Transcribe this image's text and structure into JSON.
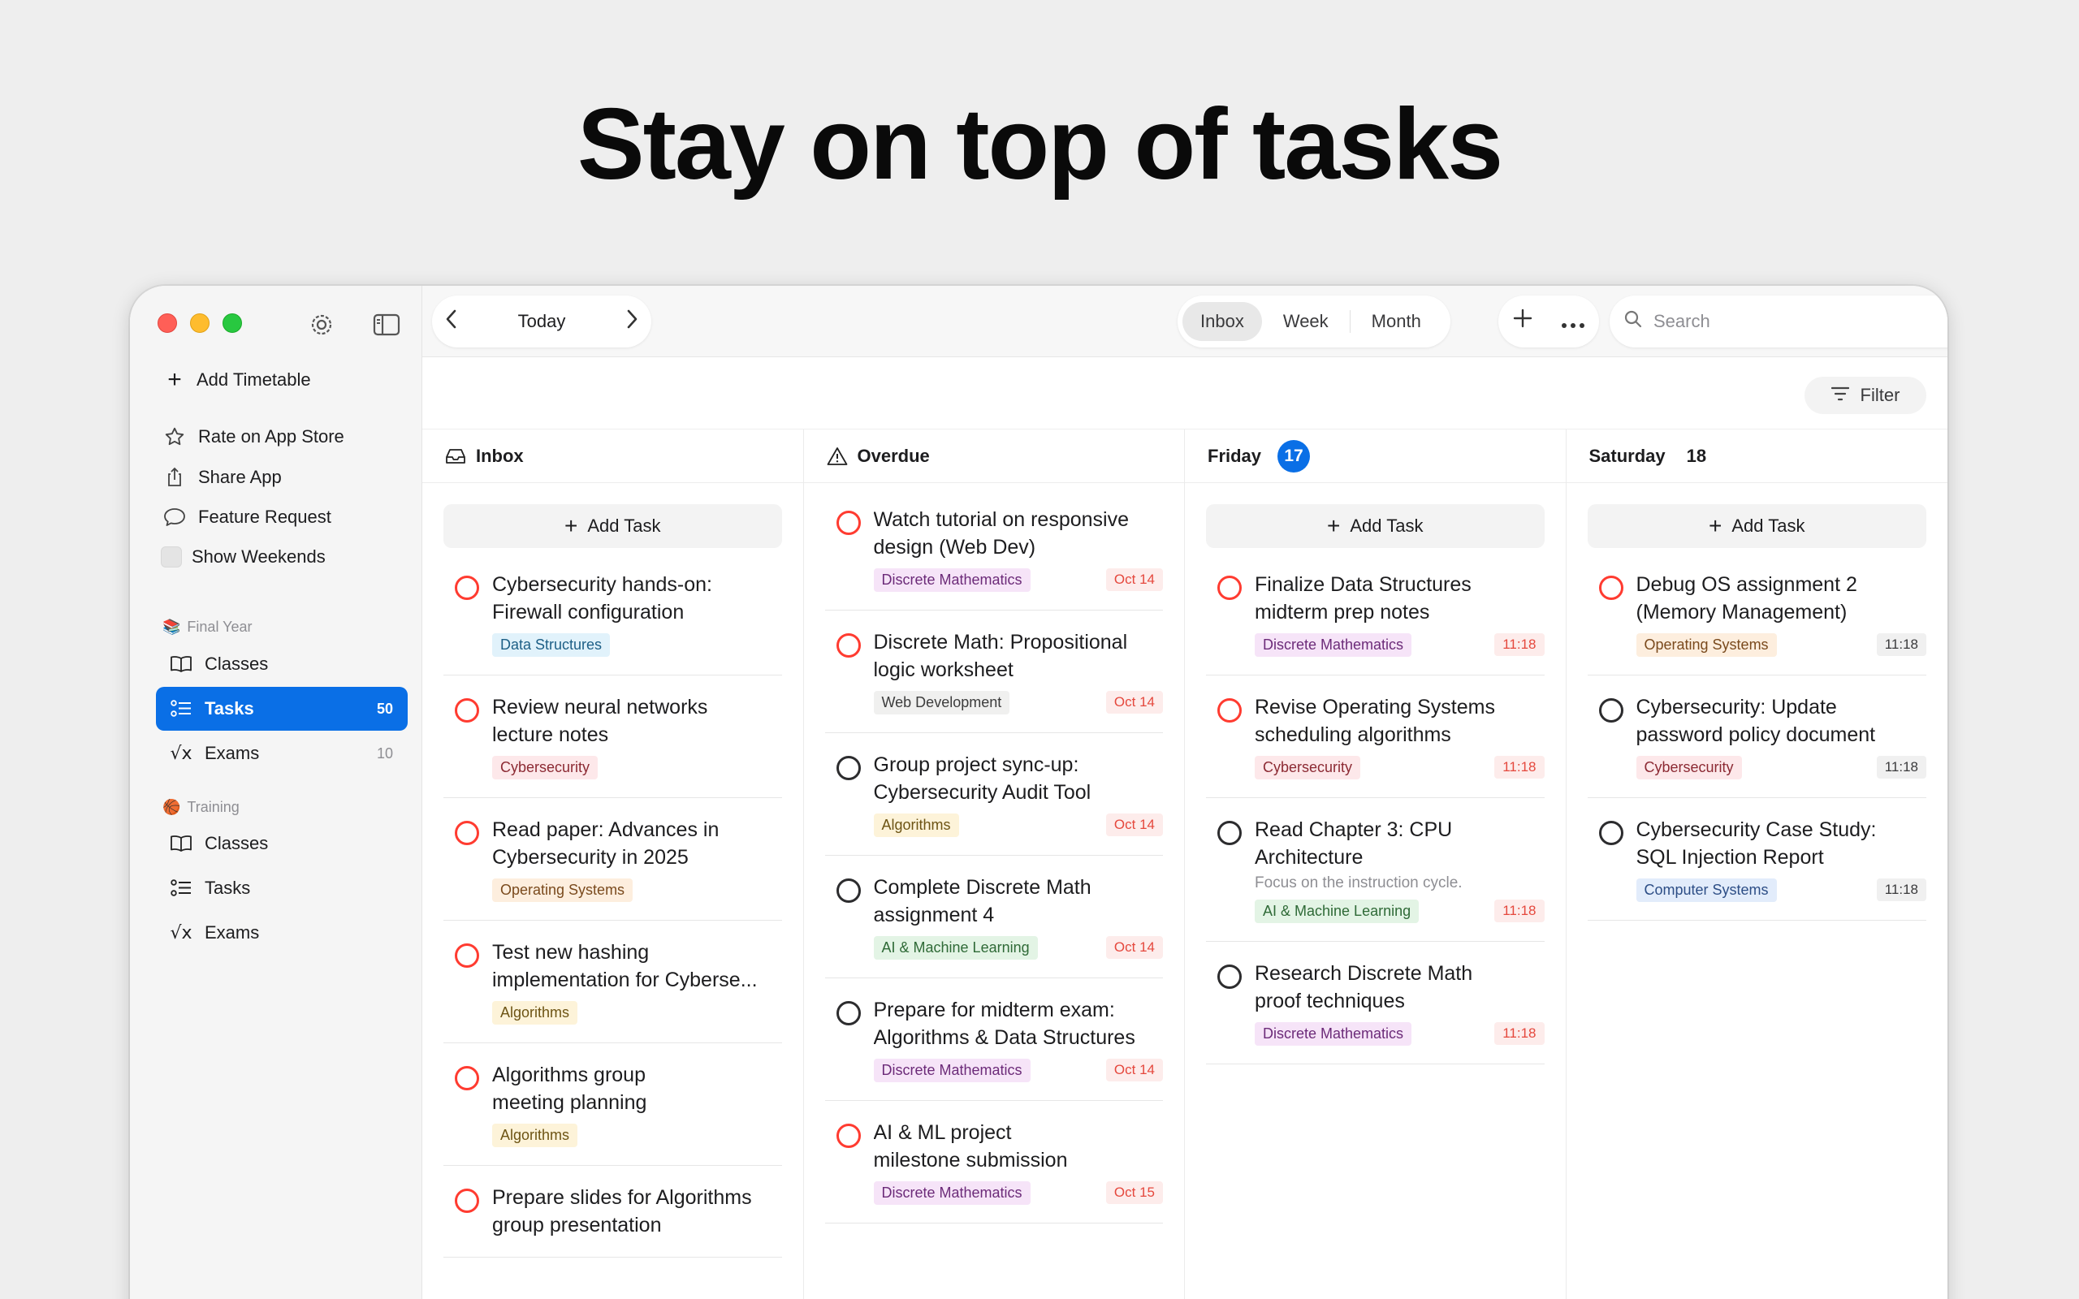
{
  "headline": "Stay on top of tasks",
  "sidebar": {
    "add_timetable": "Add Timetable",
    "rate": "Rate on App Store",
    "share": "Share App",
    "feature": "Feature Request",
    "show_weekends": "Show Weekends",
    "section1": {
      "emoji": "📚",
      "label": "Final Year"
    },
    "section2": {
      "emoji": "🏀",
      "label": "Training"
    },
    "nav1": [
      {
        "label": "Classes",
        "count": ""
      },
      {
        "label": "Tasks",
        "count": "50"
      },
      {
        "label": "Exams",
        "count": "10"
      }
    ],
    "nav2": [
      {
        "label": "Classes"
      },
      {
        "label": "Tasks"
      },
      {
        "label": "Exams"
      }
    ]
  },
  "toolbar": {
    "today": "Today",
    "segments": [
      "Inbox",
      "Week",
      "Month"
    ],
    "search_placeholder": "Search"
  },
  "filter_label": "Filter",
  "add_task_label": "Add Task",
  "tag_colors": {
    "Data Structures": [
      "#e1f2fb",
      "#1d5f86"
    ],
    "Cybersecurity": [
      "#fde8ea",
      "#8c2a33"
    ],
    "Operating Systems": [
      "#fdeede",
      "#7a4a1d"
    ],
    "Algorithms": [
      "#fdf3d9",
      "#6d5414"
    ],
    "Discrete Mathematics": [
      "#f6e4f8",
      "#6c2b79"
    ],
    "Web Development": [
      "#f0f0ef",
      "#3c3c3c"
    ],
    "AI & Machine Learning": [
      "#e3f4e5",
      "#2f6a37"
    ],
    "Computer Systems": [
      "#e2ecfb",
      "#2d4e86"
    ]
  },
  "columns": [
    {
      "title": "Inbox",
      "icon": "inbox-icon",
      "has_add": true,
      "tasks": [
        {
          "title1": "Cybersecurity hands-on:",
          "title2": "Firewall configuration",
          "tag": "Data Structures",
          "due": "",
          "circle": "red"
        },
        {
          "title1": "Review neural networks",
          "title2": "lecture notes",
          "tag": "Cybersecurity",
          "due": "",
          "circle": "red"
        },
        {
          "title1": "Read paper: Advances in",
          "title2": "Cybersecurity in 2025",
          "tag": "Operating Systems",
          "due": "",
          "circle": "red"
        },
        {
          "title1": "Test new hashing",
          "title2": "implementation for Cyberse...",
          "tag": "Algorithms",
          "due": "",
          "circle": "red"
        },
        {
          "title1": "Algorithms group",
          "title2": "meeting planning",
          "tag": "Algorithms",
          "due": "",
          "circle": "red"
        },
        {
          "title1": "Prepare slides for Algorithms",
          "title2": "group presentation",
          "tag": "",
          "due": "",
          "circle": "red"
        }
      ]
    },
    {
      "title": "Overdue",
      "icon": "warning-icon",
      "has_add": false,
      "tasks": [
        {
          "title1": "Watch tutorial on responsive",
          "title2": "design (Web Dev)",
          "tag": "Discrete Mathematics",
          "due": "Oct 14",
          "circle": "red",
          "due_style": "red"
        },
        {
          "title1": "Discrete Math: Propositional",
          "title2": "logic worksheet",
          "tag": "Web Development",
          "due": "Oct 14",
          "circle": "red",
          "due_style": "red"
        },
        {
          "title1": "Group project sync-up:",
          "title2": "Cybersecurity Audit Tool",
          "tag": "Algorithms",
          "due": "Oct 14",
          "circle": "black",
          "due_style": "red"
        },
        {
          "title1": "Complete Discrete Math",
          "title2": "assignment 4",
          "tag": "AI & Machine Learning",
          "due": "Oct 14",
          "circle": "black",
          "due_style": "red"
        },
        {
          "title1": "Prepare for midterm exam:",
          "title2": "Algorithms & Data Structures",
          "tag": "Discrete Mathematics",
          "due": "Oct 14",
          "circle": "black",
          "due_style": "red"
        },
        {
          "title1": "AI & ML project",
          "title2": "milestone submission",
          "tag": "Discrete Mathematics",
          "due": "Oct 15",
          "circle": "red",
          "due_style": "red"
        }
      ]
    },
    {
      "title": "Friday",
      "badge": "17",
      "has_add": true,
      "tasks": [
        {
          "title1": "Finalize Data Structures",
          "title2": "midterm prep notes",
          "tag": "Discrete Mathematics",
          "due": "11:18",
          "circle": "red",
          "due_style": "red"
        },
        {
          "title1": "Revise Operating Systems",
          "title2": "scheduling algorithms",
          "tag": "Cybersecurity",
          "due": "11:18",
          "circle": "red",
          "due_style": "red"
        },
        {
          "title1": "Read Chapter 3: CPU",
          "title2": "Architecture",
          "note": "Focus on the instruction cycle.",
          "tag": "AI & Machine Learning",
          "due": "11:18",
          "circle": "black",
          "due_style": "red"
        },
        {
          "title1": "Research Discrete Math",
          "title2": "proof techniques",
          "tag": "Discrete Mathematics",
          "due": "11:18",
          "circle": "black",
          "due_style": "red"
        }
      ]
    },
    {
      "title": "Saturday",
      "daynum": "18",
      "has_add": true,
      "tasks": [
        {
          "title1": "Debug OS assignment 2",
          "title2": "(Memory Management)",
          "tag": "Operating Systems",
          "due": "11:18",
          "circle": "red",
          "due_style": "grey"
        },
        {
          "title1": "Cybersecurity: Update",
          "title2": "password policy document",
          "tag": "Cybersecurity",
          "due": "11:18",
          "circle": "black",
          "due_style": "grey"
        },
        {
          "title1": "Cybersecurity Case Study:",
          "title2": "SQL Injection Report",
          "tag": "Computer Systems",
          "due": "11:18",
          "circle": "black",
          "due_style": "grey"
        }
      ]
    }
  ]
}
